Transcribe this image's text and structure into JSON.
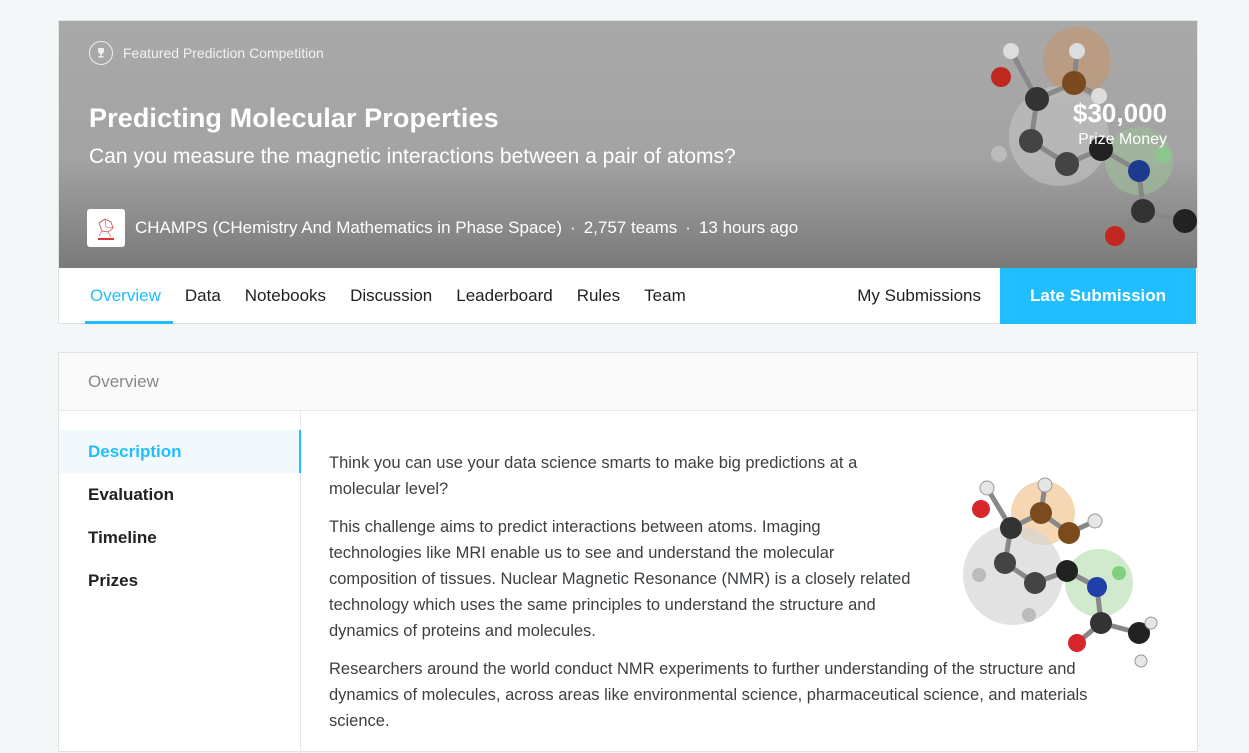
{
  "banner": {
    "featured_label": "Featured Prediction Competition",
    "title": "Predicting Molecular Properties",
    "subtitle": "Can you measure the magnetic interactions between a pair of atoms?",
    "host": "CHAMPS (CHemistry And Mathematics in Phase Space)",
    "teams": "2,757 teams",
    "time": "13 hours ago",
    "separator": "·",
    "prize_amount": "$30,000",
    "prize_label": "Prize Money"
  },
  "tabs": {
    "items": [
      {
        "label": "Overview",
        "active": true
      },
      {
        "label": "Data"
      },
      {
        "label": "Notebooks"
      },
      {
        "label": "Discussion"
      },
      {
        "label": "Leaderboard"
      },
      {
        "label": "Rules"
      },
      {
        "label": "Team"
      }
    ],
    "my_submissions": "My Submissions",
    "late_submission": "Late Submission"
  },
  "overview": {
    "header": "Overview",
    "sidebar": [
      {
        "label": "Description",
        "active": true
      },
      {
        "label": "Evaluation"
      },
      {
        "label": "Timeline"
      },
      {
        "label": "Prizes"
      }
    ],
    "paragraphs": [
      "Think you can use your data science smarts to make big predictions at a molecular level?",
      "This challenge aims to predict interactions between atoms. Imaging technologies like MRI enable us to see and understand the molecular composition of tissues. Nuclear Magnetic Resonance (NMR) is a closely related technology which uses the same principles to understand the structure and dynamics of proteins and molecules.",
      "Researchers around the world conduct NMR experiments to further understanding of the structure and dynamics of molecules, across areas like environmental science, pharmaceutical science, and materials science."
    ]
  },
  "colors": {
    "accent": "#20beff",
    "banner_gray": "#a6a6a6"
  },
  "icons": {
    "featured": "trophy-icon",
    "molecule": "molecule-illustration"
  }
}
